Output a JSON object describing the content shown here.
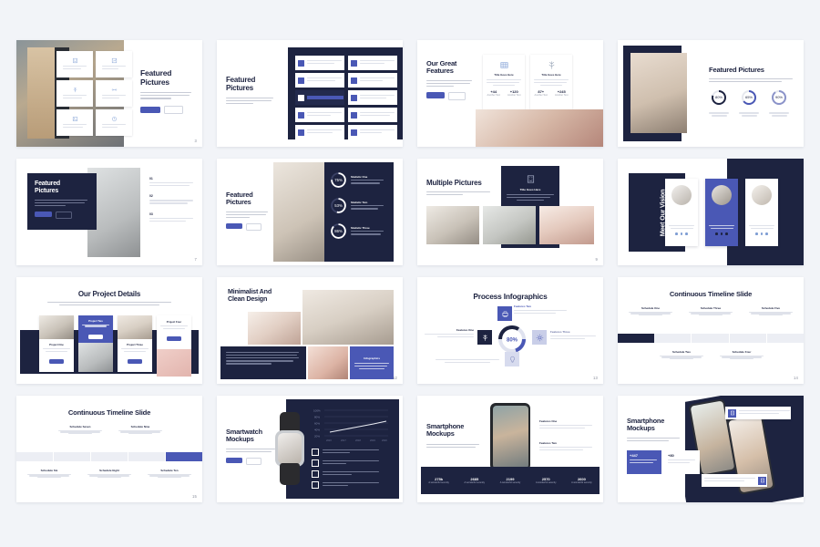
{
  "page": {
    "background_color": "#f2f4f8",
    "accent_color": "#4a58b5",
    "navy_color": "#1d2340",
    "layout": "4x4 grid of presentation slide thumbnails"
  },
  "slides": [
    {
      "id": "slide-1",
      "title": "Featured\nPictures",
      "title_line1": "Featured",
      "title_line2": "Pictures",
      "page_number": "3",
      "buttons": [
        "Read More",
        "Learn More"
      ],
      "cards": 6,
      "card_icons": [
        "building-icon",
        "chart-icon",
        "tree-icon",
        "connect-icon",
        "image-icon",
        "clock-icon"
      ],
      "layout": "photo left with icon card grid, text panel right"
    },
    {
      "id": "slide-2",
      "title_line1": "Featured",
      "title_line2": "Pictures",
      "page_number": "",
      "list_items": 10,
      "highlight_index": 4,
      "layout": "text panel left, navy list grid right"
    },
    {
      "id": "slide-3",
      "title_line1": "Our Great",
      "title_line2": "Features",
      "page_number": "",
      "buttons": [
        "Read More",
        "Learn More"
      ],
      "feature_cards": [
        {
          "title": "Title Goes Here",
          "stat_left": "+44",
          "stat_right": "+120",
          "stat_left_label": "Another Text",
          "stat_right_label": "Another Text",
          "icon": "grid-icon"
        },
        {
          "title": "Title Goes Here",
          "stat_left": "87+",
          "stat_right": "+245",
          "stat_left_label": "Another Text",
          "stat_right_label": "Another Text",
          "icon": "tree-icon"
        }
      ],
      "layout": "headline left, two feature cards, photo bottom"
    },
    {
      "id": "slide-4",
      "title": "Featured Pictures",
      "page_number": "",
      "donuts": [
        {
          "value": "80%",
          "color": "#1d2340"
        },
        {
          "value": "65%",
          "color": "#4a58b5"
        },
        {
          "value": "90%",
          "color": "#8b93c9"
        }
      ],
      "layout": "framed photo left, headline and three donut charts right"
    },
    {
      "id": "slide-5",
      "title_line1": "Featured",
      "title_line2": "Pictures",
      "page_number": "7",
      "buttons": [
        "Read More",
        "Learn More"
      ],
      "numbered_items": [
        "01",
        "02",
        "03"
      ],
      "layout": "navy text card over photo, numbered list right"
    },
    {
      "id": "slide-6",
      "title_line1": "Featured",
      "title_line2": "Pictures",
      "page_number": "",
      "buttons": [
        "Read More",
        "Learn More"
      ],
      "stats": [
        {
          "value": "75%",
          "label": "Statistic One"
        },
        {
          "value": "53%",
          "label": "Statistic Two"
        },
        {
          "value": "86%",
          "label": "Statistic Three"
        }
      ],
      "layout": "text left, photo centre, navy stats panel right"
    },
    {
      "id": "slide-7",
      "title": "Multiple Pictures",
      "page_number": "9",
      "overlay_card_title": "Title Goes Here",
      "overlay_icon": "building-icon",
      "photo_count": 3,
      "layout": "headline left, navy overlay card, three photos"
    },
    {
      "id": "slide-8",
      "title": "Meet Our Vision",
      "page_number": "",
      "cards": [
        {
          "highlight": false,
          "dots": 3
        },
        {
          "highlight": true,
          "dots": 3
        },
        {
          "highlight": false,
          "dots": 3
        }
      ],
      "layout": "vertical navy title bar, three portrait cards, middle highlighted"
    },
    {
      "id": "slide-9",
      "title": "Our Project Details",
      "page_number": "",
      "projects": [
        {
          "label": "Project One",
          "button": "Read More",
          "highlight": false
        },
        {
          "label": "Project Two",
          "button": "Read More",
          "highlight": true
        },
        {
          "label": "Project Three",
          "button": "Read More",
          "highlight": false
        },
        {
          "label": "Project Four",
          "button": "Read More",
          "highlight": false
        }
      ],
      "layout": "centred headline, four project cards over navy band"
    },
    {
      "id": "slide-10",
      "title_line1": "Minimalist And",
      "title_line2": "Clean Design",
      "page_number": "12",
      "infographic_label": "Infographics",
      "layout": "headline and photo mosaic, navy text block, blue infographic tile"
    },
    {
      "id": "slide-11",
      "title": "Process Infographics",
      "page_number": "13",
      "centre_value": "80%",
      "features": [
        {
          "label": "Features One",
          "icon": "tree-icon"
        },
        {
          "label": "Features Two",
          "icon": "print-icon"
        },
        {
          "label": "Features Three",
          "icon": "gear-icon"
        },
        {
          "label": "Features Four",
          "icon": "bulb-icon"
        }
      ],
      "layout": "circular process diagram with four labelled icon tiles"
    },
    {
      "id": "slide-12",
      "title": "Continuous Timeline Slide",
      "page_number": "14",
      "active_index": 0,
      "steps": [
        {
          "label": "Schedule One",
          "position": "top"
        },
        {
          "label": "Schedule Two",
          "position": "bottom"
        },
        {
          "label": "Schedule Three",
          "position": "top"
        },
        {
          "label": "Schedule Four",
          "position": "bottom"
        },
        {
          "label": "Schedule Five",
          "position": "top"
        }
      ],
      "active_color": "#1d2340",
      "layout": "horizontal timeline bar with five segments, first active (navy)"
    },
    {
      "id": "slide-13",
      "title": "Continuous Timeline Slide",
      "page_number": "15",
      "active_index": 4,
      "steps": [
        {
          "label": "Schedule Six",
          "position": "bottom"
        },
        {
          "label": "Schedule Seven",
          "position": "top"
        },
        {
          "label": "Schedule Eight",
          "position": "bottom"
        },
        {
          "label": "Schedule Nine",
          "position": "top"
        },
        {
          "label": "Schedule Ten",
          "position": "bottom"
        }
      ],
      "active_color": "#4a58b5",
      "layout": "horizontal timeline bar with five segments, last active (blue)"
    },
    {
      "id": "slide-14",
      "title_line1": "Smartwatch",
      "title_line2": "Mockups",
      "page_number": "",
      "buttons": [
        "Read More",
        "Learn More"
      ],
      "checklist_items": 4,
      "chart": {
        "type": "line",
        "y_ticks": [
          "100%",
          "80%",
          "60%",
          "40%",
          "20%"
        ],
        "x_ticks": [
          "2016",
          "2017",
          "2018",
          "2019",
          "2020"
        ],
        "values": [
          38,
          46,
          56,
          66,
          74
        ],
        "line_color": "#ffffff"
      },
      "layout": "text left, smartwatch mockup, navy panel with line chart and checklist"
    },
    {
      "id": "slide-15",
      "title_line1": "Smartphone",
      "title_line2": "Mockups",
      "page_number": "",
      "features": [
        {
          "title": "Features One"
        },
        {
          "title": "Features Two"
        }
      ],
      "stats_bar": [
        {
          "value": "275k",
          "label": "A wonderful serenity"
        },
        {
          "value": "2685",
          "label": "A wonderful serenity"
        },
        {
          "value": "2199",
          "label": "A wonderful serenity"
        },
        {
          "value": "2570",
          "label": "A wonderful serenity"
        },
        {
          "value": "2600",
          "label": "A wonderful serenity"
        }
      ],
      "layout": "headline left, phone mockup centre, features right, navy stats bar bottom"
    },
    {
      "id": "slide-16",
      "title_line1": "Smartphone",
      "title_line2": "Mockups",
      "page_number": "",
      "stats": [
        {
          "value": "+447",
          "highlight": true
        },
        {
          "value": "+80",
          "highlight": false
        }
      ],
      "callouts": [
        {
          "icon": "building-icon",
          "position": "top"
        },
        {
          "icon": "building-icon",
          "position": "bottom"
        }
      ],
      "layout": "headline and stat tiles left, tilted navy panel with two phone mockups and callouts"
    }
  ]
}
